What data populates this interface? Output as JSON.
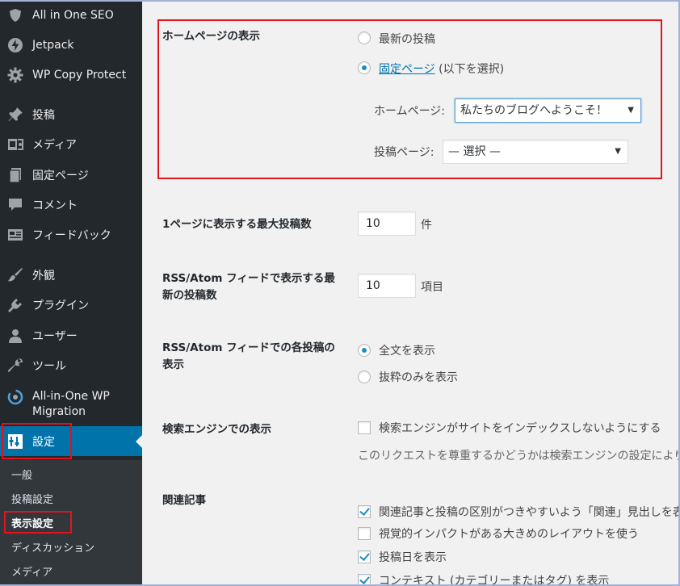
{
  "sidebar": {
    "items": [
      {
        "label": "All in One SEO",
        "icon": "shield-icon"
      },
      {
        "label": "Jetpack",
        "icon": "jetpack-bolt-icon"
      },
      {
        "label": "WP Copy Protect",
        "icon": "gear-icon"
      },
      {
        "label": "投稿",
        "icon": "pushpin-icon"
      },
      {
        "label": "メディア",
        "icon": "media-icon"
      },
      {
        "label": "固定ページ",
        "icon": "pages-icon"
      },
      {
        "label": "コメント",
        "icon": "comment-bubble-icon"
      },
      {
        "label": "フィードバック",
        "icon": "feedback-icon"
      },
      {
        "label": "外観",
        "icon": "paintbrush-icon"
      },
      {
        "label": "プラグイン",
        "icon": "plugin-plug-icon"
      },
      {
        "label": "ユーザー",
        "icon": "user-icon"
      },
      {
        "label": "ツール",
        "icon": "wrench-icon"
      },
      {
        "label": "All-in-One WP Migration",
        "icon": "migration-icon"
      },
      {
        "label": "設定",
        "icon": "settings-sliders-icon"
      }
    ],
    "submenu": [
      "一般",
      "投稿設定",
      "表示設定",
      "ディスカッション",
      "メディア"
    ]
  },
  "homepage": {
    "label": "ホームページの表示",
    "option_latest": "最新の投稿",
    "option_static_link": "固定ページ",
    "option_static_suffix": " (以下を選択)",
    "selected_option": "static",
    "homepage_label": "ホームページ:",
    "homepage_value": "私たちのブログへようこそ！",
    "postspage_label": "投稿ページ:",
    "postspage_value": "— 選択 —"
  },
  "posts_per_page": {
    "label": "1ページに表示する最大投稿数",
    "value": "10",
    "suffix": "件"
  },
  "rss_count": {
    "label": "RSS/Atom フィードで表示する最新の投稿数",
    "value": "10",
    "suffix": "項目"
  },
  "rss_display": {
    "label": "RSS/Atom フィードでの各投稿の表示",
    "option_full": "全文を表示",
    "option_summary": "抜粋のみを表示",
    "selected": "full"
  },
  "search_engine": {
    "label": "検索エンジンでの表示",
    "checkbox_text": "検索エンジンがサイトをインデックスしないようにする",
    "description": "このリクエストを尊重するかどうかは検索エンジンの設定によります。",
    "checked": false
  },
  "related": {
    "label": "関連記事",
    "options": [
      {
        "text": "関連記事と投稿の区別がつきやすいよう「関連」見出しを表示",
        "checked": true
      },
      {
        "text": "視覚的インパクトがある大きめのレイアウトを使う",
        "checked": false
      },
      {
        "text": "投稿日を表示",
        "checked": true
      },
      {
        "text": "コンテキスト (カテゴリーまたはタグ) を表示",
        "checked": true
      }
    ]
  },
  "colors": {
    "sidebar_bg": "#23282d",
    "accent": "#0073aa",
    "highlight_red": "#e5121b"
  }
}
